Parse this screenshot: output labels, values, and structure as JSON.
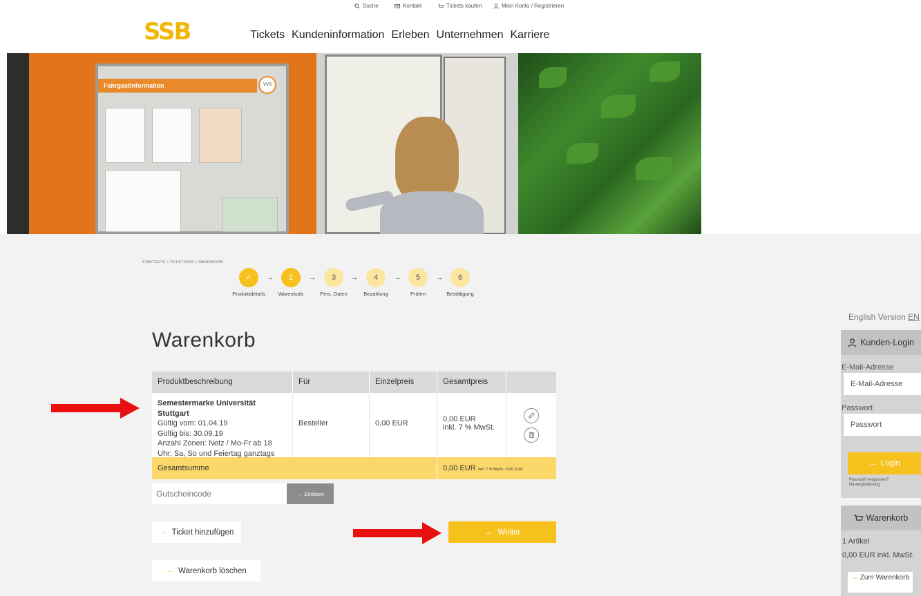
{
  "utility": {
    "search": "Suche",
    "contact": "Kontakt",
    "tickets_buy": "Tickets kaufen",
    "account": "Mein Konto / Registrieren"
  },
  "logo": "SSB",
  "nav": [
    "Tickets",
    "Kundeninformation",
    "Erleben",
    "Unternehmen",
    "Karriere"
  ],
  "hero": {
    "board_header": "Fahrgastinformation",
    "board_logo": "VVS"
  },
  "breadcrumb": "STARTSEITE  >  TICKETSHOP  >  WARENKORB",
  "steps": [
    {
      "number": "✓",
      "label": "Produktdetails"
    },
    {
      "number": "2",
      "label": "Warenkorb"
    },
    {
      "number": "3",
      "label": "Pers. Daten"
    },
    {
      "number": "4",
      "label": "Bezahlung"
    },
    {
      "number": "5",
      "label": "Prüfen"
    },
    {
      "number": "6",
      "label": "Bestätigung"
    }
  ],
  "page_title": "Warenkorb",
  "table": {
    "headers": [
      "Produktbeschreibung",
      "Für",
      "Einzelpreis",
      "Gesamtpreis",
      ""
    ],
    "row": {
      "product_name": "Semestermarke Universität Stuttgart",
      "valid_from": "Gültig vom: 01.04.19",
      "valid_to": "Gültig bis: 30.09.19",
      "zones": "Anzahl Zonen: Netz / Mo-Fr ab 18 Uhr; Sa, So und Feiertag ganztags",
      "for": "Besteller",
      "unit_price": "0,00 EUR",
      "total_price": "0,00 EUR",
      "vat": "inkl. 7 % MwSt."
    },
    "sum_label": "Gesamtsumme",
    "sum_value": "0,00 EUR",
    "sum_vat": "inkl. 7 % MwSt.: 0,00 EUR"
  },
  "voucher": {
    "placeholder": "Gutscheincode",
    "button": "Einlösen"
  },
  "buttons": {
    "add_ticket": "Ticket hinzufügen",
    "next": "Weiter",
    "clear_cart": "Warenkorb löschen"
  },
  "sidebar": {
    "english": "English Version",
    "english_code": "EN",
    "login_title": "Kunden-Login",
    "email_label": "E-Mail-Adresse",
    "email_placeholder": "E-Mail-Adresse",
    "password_label": "Passwort",
    "password_placeholder": "Passwort",
    "login_button": "Login",
    "forgot": "Passwort vergessen?",
    "register": "Neuregistrierung",
    "cart_title": "Warenkorb",
    "cart_items": "1 Artikel",
    "cart_total": "0,00 EUR inkl. MwSt.",
    "to_cart": "Zum Warenkorb"
  },
  "colors": {
    "brand_yellow": "#f7c11d",
    "light_yellow": "#fcd86a",
    "annotation_red": "#e8100f"
  }
}
